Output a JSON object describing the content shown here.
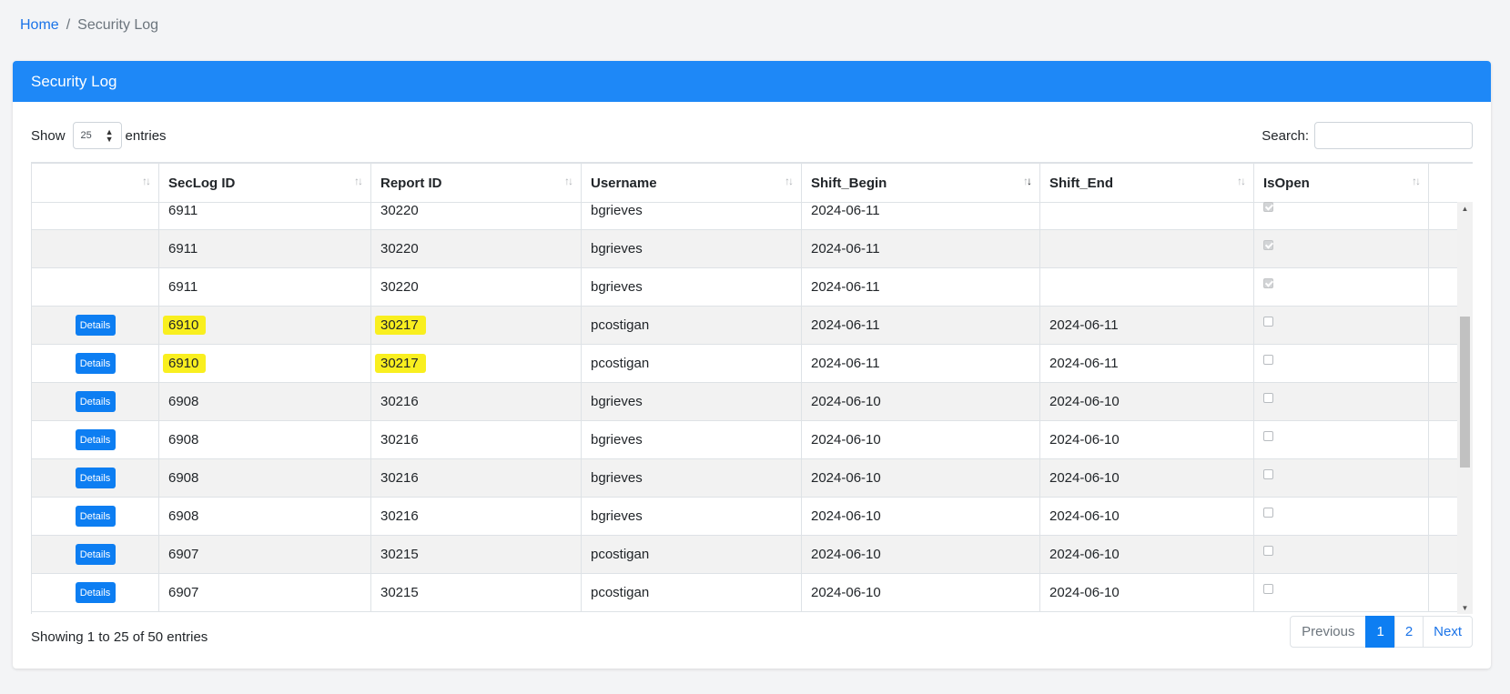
{
  "breadcrumb": {
    "home": "Home",
    "separator": "/",
    "current": "Security Log"
  },
  "card": {
    "title": "Security Log"
  },
  "length": {
    "show": "Show",
    "value": "25",
    "entries": "entries"
  },
  "search": {
    "label": "Search:",
    "value": ""
  },
  "columns": [
    "",
    "SecLog ID",
    "Report ID",
    "Username",
    "Shift_Begin",
    "Shift_End",
    "IsOpen"
  ],
  "sorted_column": "Shift_Begin",
  "sort_direction": "descending",
  "details_label": "Details",
  "rows": [
    {
      "details": false,
      "seclog_id": "6911",
      "report_id": "30220",
      "username": "bgrieves",
      "shift_begin": "2024-06-11",
      "shift_end": "",
      "is_open": true,
      "highlight": false
    },
    {
      "details": false,
      "seclog_id": "6911",
      "report_id": "30220",
      "username": "bgrieves",
      "shift_begin": "2024-06-11",
      "shift_end": "",
      "is_open": true,
      "highlight": false
    },
    {
      "details": false,
      "seclog_id": "6911",
      "report_id": "30220",
      "username": "bgrieves",
      "shift_begin": "2024-06-11",
      "shift_end": "",
      "is_open": true,
      "highlight": false
    },
    {
      "details": true,
      "seclog_id": "6910",
      "report_id": "30217",
      "username": "pcostigan",
      "shift_begin": "2024-06-11",
      "shift_end": "2024-06-11",
      "is_open": false,
      "highlight": true
    },
    {
      "details": true,
      "seclog_id": "6910",
      "report_id": "30217",
      "username": "pcostigan",
      "shift_begin": "2024-06-11",
      "shift_end": "2024-06-11",
      "is_open": false,
      "highlight": true
    },
    {
      "details": true,
      "seclog_id": "6908",
      "report_id": "30216",
      "username": "bgrieves",
      "shift_begin": "2024-06-10",
      "shift_end": "2024-06-10",
      "is_open": false,
      "highlight": false
    },
    {
      "details": true,
      "seclog_id": "6908",
      "report_id": "30216",
      "username": "bgrieves",
      "shift_begin": "2024-06-10",
      "shift_end": "2024-06-10",
      "is_open": false,
      "highlight": false
    },
    {
      "details": true,
      "seclog_id": "6908",
      "report_id": "30216",
      "username": "bgrieves",
      "shift_begin": "2024-06-10",
      "shift_end": "2024-06-10",
      "is_open": false,
      "highlight": false
    },
    {
      "details": true,
      "seclog_id": "6908",
      "report_id": "30216",
      "username": "bgrieves",
      "shift_begin": "2024-06-10",
      "shift_end": "2024-06-10",
      "is_open": false,
      "highlight": false
    },
    {
      "details": true,
      "seclog_id": "6907",
      "report_id": "30215",
      "username": "pcostigan",
      "shift_begin": "2024-06-10",
      "shift_end": "2024-06-10",
      "is_open": false,
      "highlight": false
    },
    {
      "details": true,
      "seclog_id": "6907",
      "report_id": "30215",
      "username": "pcostigan",
      "shift_begin": "2024-06-10",
      "shift_end": "2024-06-10",
      "is_open": false,
      "highlight": false
    }
  ],
  "info": "Showing 1 to 25 of 50 entries",
  "pagination": {
    "previous": "Previous",
    "pages": [
      "1",
      "2"
    ],
    "active": "1",
    "next": "Next"
  },
  "colors": {
    "accent": "#1e88f7",
    "button": "#0d7ef2",
    "highlight": "#f9ef1f",
    "link": "#1a73e8"
  }
}
